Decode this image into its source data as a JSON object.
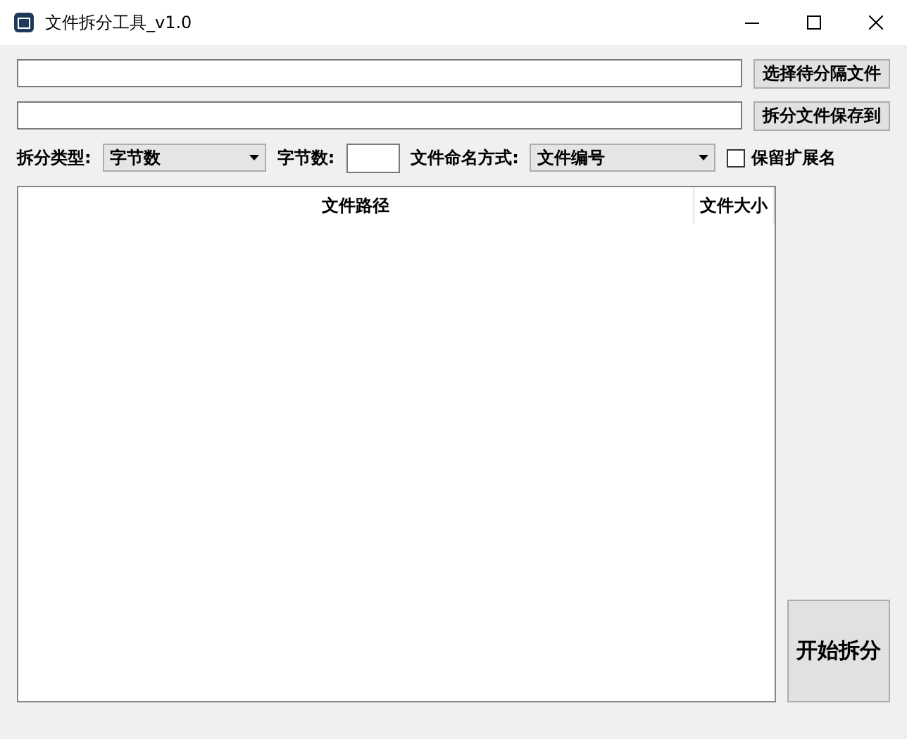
{
  "window": {
    "title": "文件拆分工具_v1.0"
  },
  "source_row": {
    "button": "选择待分隔文件"
  },
  "target_row": {
    "button": "拆分文件保存到"
  },
  "options": {
    "split_type_label": "拆分类型:",
    "split_type": "字节数",
    "size_label": "字节数:",
    "naming_label": "文件命名方式:",
    "naming": "文件编号",
    "keep_ext": {
      "label": "保留扩展名",
      "checked": false
    }
  },
  "table": {
    "columns": [
      "文件路径",
      "文件大小"
    ]
  },
  "start_button": "开始拆分"
}
